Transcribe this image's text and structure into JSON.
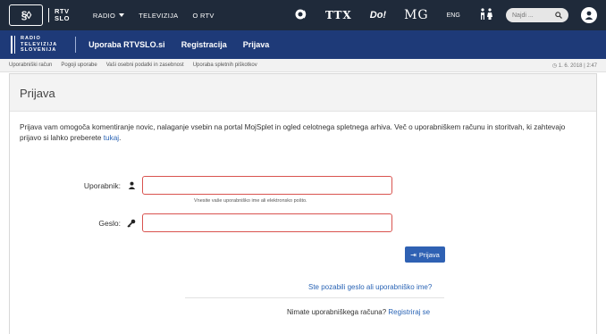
{
  "topbar": {
    "logo_text": "§◊",
    "logo_rtv_line1": "RTV",
    "logo_rtv_line2": "SLO",
    "nav": [
      {
        "label": "RADIO",
        "has_dropdown": true
      },
      {
        "label": "TELEVIZIJA",
        "has_dropdown": false
      },
      {
        "label": "O RTV",
        "has_dropdown": false
      }
    ],
    "brands": [
      "radio-icon",
      "TTX",
      "Dol",
      "MG",
      "ENG",
      "accessibility-icon"
    ],
    "brand_labels": {
      "ttx": "TTX",
      "dol": "Do!",
      "mg": "MG",
      "eng": "ENG"
    },
    "search_placeholder": "Najdi ...",
    "colors": {
      "bg": "#1f2a3a"
    }
  },
  "secbar": {
    "logo_lines": [
      "RADIO",
      "TELEVIZIJA",
      "SLOVENIJA"
    ],
    "nav": [
      "Uporaba RTVSLO.si",
      "Registracija",
      "Prijava"
    ],
    "colors": {
      "bg": "#1e3a78"
    }
  },
  "subbar": {
    "links": [
      "Uporabniški račun",
      "Pogoji uporabe",
      "Vaši osebni podatki in zasebnost",
      "Uporaba spletnih piškotkov"
    ],
    "datetime": "1. 6. 2018 | 2:47"
  },
  "main": {
    "title": "Prijava",
    "intro_text": "Prijava vam omogoča komentiranje novic, nalaganje vsebin na portal MojSplet in ogled celotnega spletnega arhiva. Več o uporabniškem računu in storitvah, ki zahtevajo prijavo si lahko preberete ",
    "intro_link": "tukaj",
    "intro_end": ".",
    "form": {
      "username_label": "Uporabnik:",
      "username_value": "",
      "username_help": "Vnesite vaše uporabniško ime ali elektronsko pošto.",
      "password_label": "Geslo:",
      "password_value": "",
      "submit_label": "Prijava"
    },
    "forgot_link": "Ste pozabili geslo ali uporabniško ime?",
    "no_account_text": "Nimate uporabniškega računa? ",
    "register_link": "Registriraj se",
    "colors": {
      "accent": "#2f61b3",
      "link": "#2a64b5",
      "error_border": "#d9534f"
    }
  }
}
